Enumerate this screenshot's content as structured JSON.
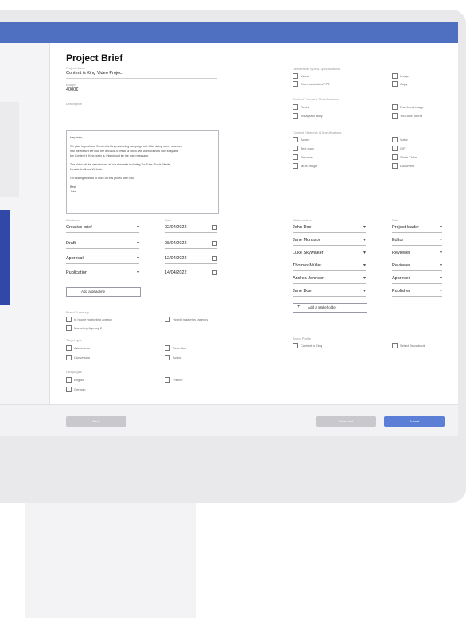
{
  "brief": {
    "title": "Project Brief",
    "project_name_label": "Project Name",
    "project_name": "Content is King Video Project",
    "budget_label": "Budget",
    "budget": "4000€",
    "description_label": "Description",
    "description_lines": [
      "Hey team,",
      "",
      "We plan to push our Content is King marketing campaign out. After doing some research",
      "into the market we took the decision to make a video. We want to show how easy and",
      "fun Content is King really is, this should be the main message.",
      "",
      "The video will be used across all our channels including YouTube, Social Media,",
      "Newsletter & our Website.",
      "",
      "I'm looking forward to work on this project with you!",
      "",
      "Best",
      "John"
    ]
  },
  "milestones": {
    "label": "Milestone",
    "date_label": "Date",
    "items": [
      {
        "name": "Creative brief",
        "date": "02/04/2022"
      },
      {
        "name": "Draft",
        "date": "08/04/2022"
      },
      {
        "name": "Approval",
        "date": "12/04/2022"
      },
      {
        "name": "Publication",
        "date": "14/04/2022"
      }
    ],
    "add_label": "Add a deadline"
  },
  "small_sections": {
    "a": {
      "label": "Brand Summary",
      "items": [
        "In house marketing agency",
        "Hybrid marketing agency",
        "Marketing Agency 2"
      ]
    },
    "b": {
      "label": "Target type",
      "items": [
        "Awareness",
        "Retention",
        "Conversion",
        "Action"
      ]
    },
    "c": {
      "label": "Languages",
      "items": [
        "English",
        "French",
        "German"
      ]
    }
  },
  "deliverables": {
    "group1": {
      "label": "Deliverable Type & Specifications",
      "items": [
        "Video",
        "Image",
        "Communication/PPT",
        "Copy"
      ]
    },
    "group2": {
      "label": "Content Format & Specifications",
      "items": [
        "Reels",
        "Facebook image",
        "Instagram story",
        "YouTube shorts"
      ]
    },
    "group3": {
      "label": "Content Elements & Specifications",
      "items": [
        "Actors",
        "Voice",
        "Text copy",
        "GIF",
        "Carousel",
        "Stock Video",
        "Multi-image",
        "Document"
      ]
    }
  },
  "stakeholders": {
    "label": "Stakeholders",
    "role_label": "Role",
    "items": [
      {
        "name": "John Doe",
        "role": "Project leader"
      },
      {
        "name": "Jane Monsson",
        "role": "Editor"
      },
      {
        "name": "Luke Skywalker",
        "role": "Reviewer"
      },
      {
        "name": "Thomas Müller",
        "role": "Reviewer"
      },
      {
        "name": "Andrea Johnson",
        "role": "Approver"
      },
      {
        "name": "Jane Doe",
        "role": "Publisher"
      }
    ],
    "add_label": "Add a stakeholder"
  },
  "accounts": {
    "label": "Brand Profile",
    "items": [
      "Content is King",
      "Select Brandbook"
    ]
  },
  "footer": {
    "back_label": "Back",
    "save_label": "Save draft",
    "submit_label": "Submit"
  },
  "colors": {
    "accent": "#4f6fc0",
    "submit": "#5b7ed6",
    "grey_button": "#c9c9cd"
  }
}
